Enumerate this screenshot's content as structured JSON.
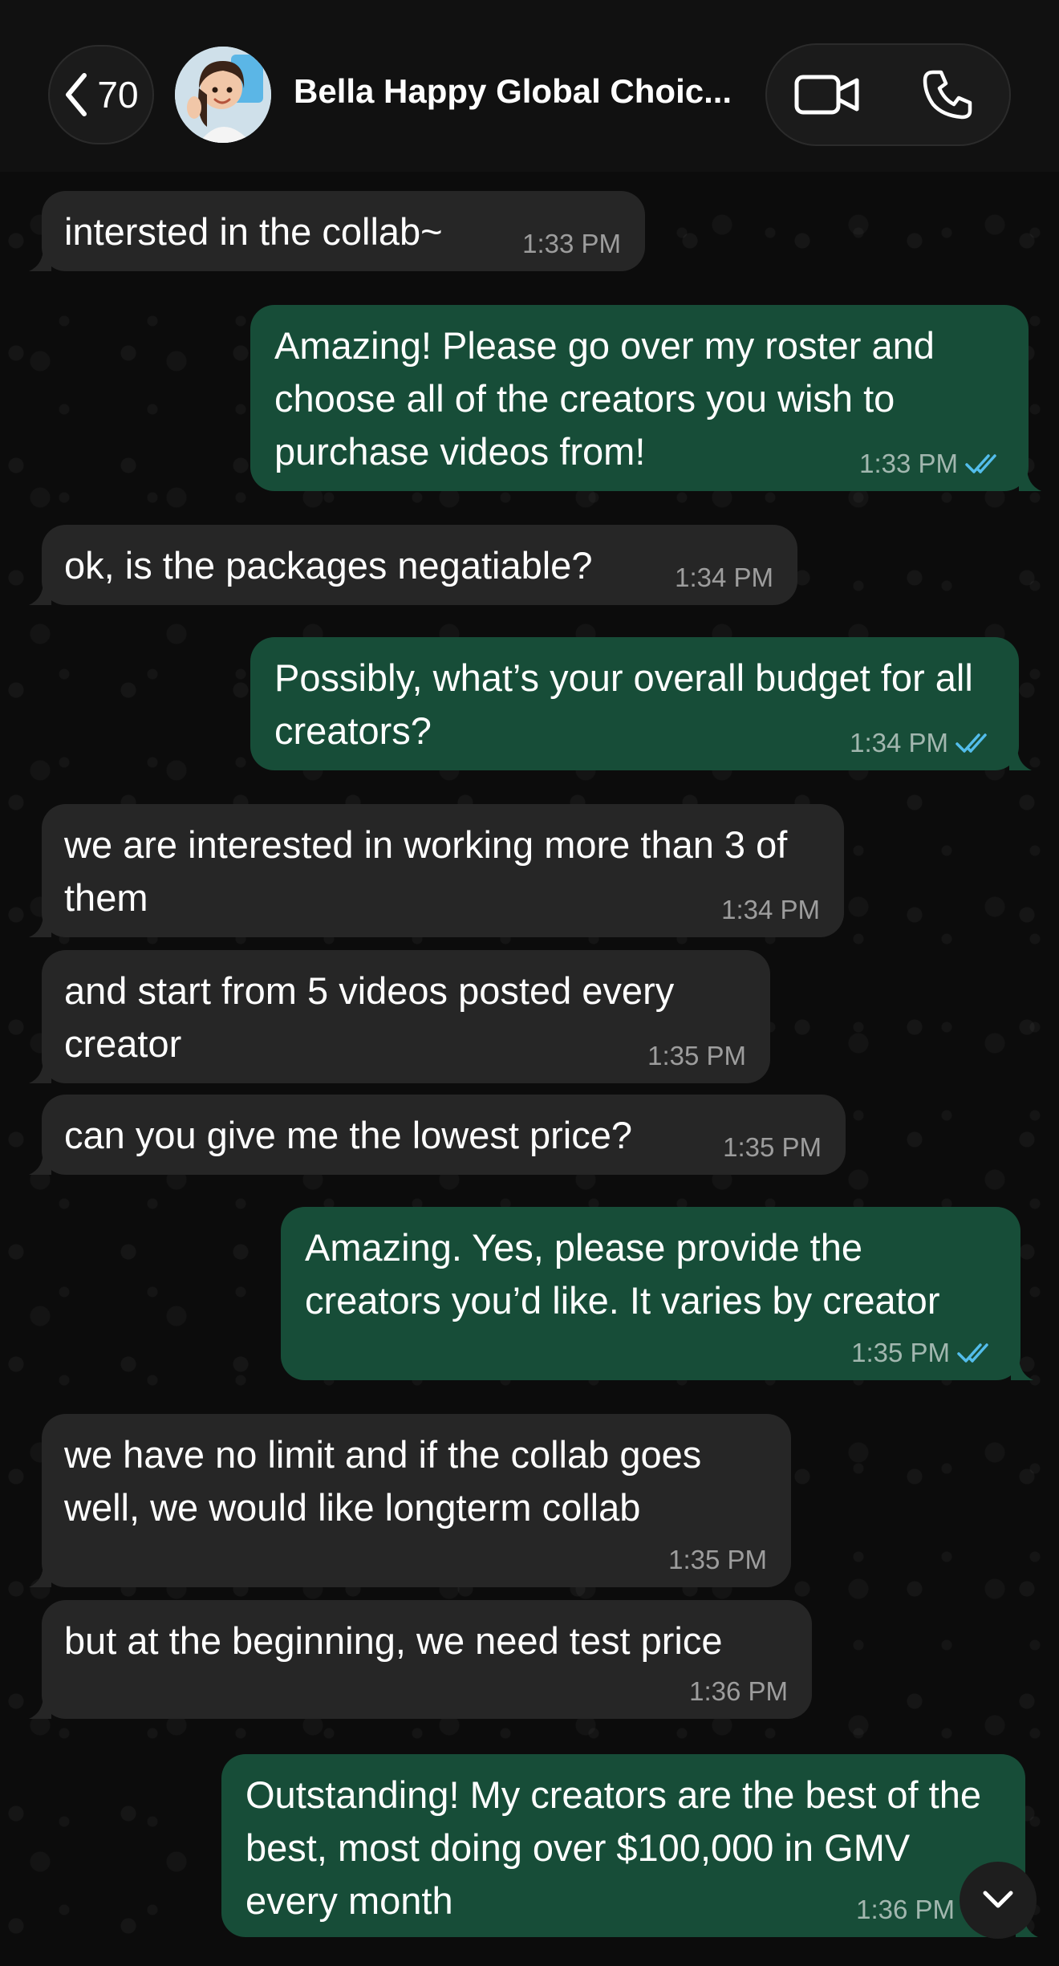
{
  "header": {
    "back_count": "70",
    "contact_name": "Bella Happy Global Choic..."
  },
  "colors": {
    "incoming_bubble": "#262626",
    "outgoing_bubble": "#174d38",
    "read_tick": "#53bdeb"
  },
  "messages": [
    {
      "dir": "in",
      "text": "intersted in the collab~",
      "time": "1:33 PM"
    },
    {
      "dir": "out",
      "text": "Amazing! Please go over my roster and choose all of the creators you wish to purchase videos from!",
      "time": "1:33 PM",
      "status": "read"
    },
    {
      "dir": "in",
      "text": "ok, is the packages negatiable?",
      "time": "1:34 PM"
    },
    {
      "dir": "out",
      "text": "Possibly, what’s your overall budget for all creators?",
      "time": "1:34 PM",
      "status": "read"
    },
    {
      "dir": "in",
      "text": "we are interested in working more than 3 of them",
      "time": "1:34 PM"
    },
    {
      "dir": "in",
      "text": "and start from 5 videos posted every creator",
      "time": "1:35 PM"
    },
    {
      "dir": "in",
      "text": "can you give me the lowest price?",
      "time": "1:35 PM"
    },
    {
      "dir": "out",
      "text": "Amazing. Yes, please provide the creators you’d like. It varies by creator",
      "time": "1:35 PM",
      "status": "read"
    },
    {
      "dir": "in",
      "text": "we have no limit and if the collab goes well, we would like longterm collab",
      "time": "1:35 PM"
    },
    {
      "dir": "in",
      "text": "but at the beginning, we need test price",
      "time": "1:36 PM"
    },
    {
      "dir": "out",
      "text": "Outstanding! My creators are the best of the best, most doing over $100,000 in GMV every month",
      "time": "1:36 PM",
      "status": "read"
    }
  ],
  "icons": {
    "back": "chevron-left-icon",
    "video": "video-camera-icon",
    "phone": "phone-icon",
    "scroll": "chevron-down-icon"
  }
}
